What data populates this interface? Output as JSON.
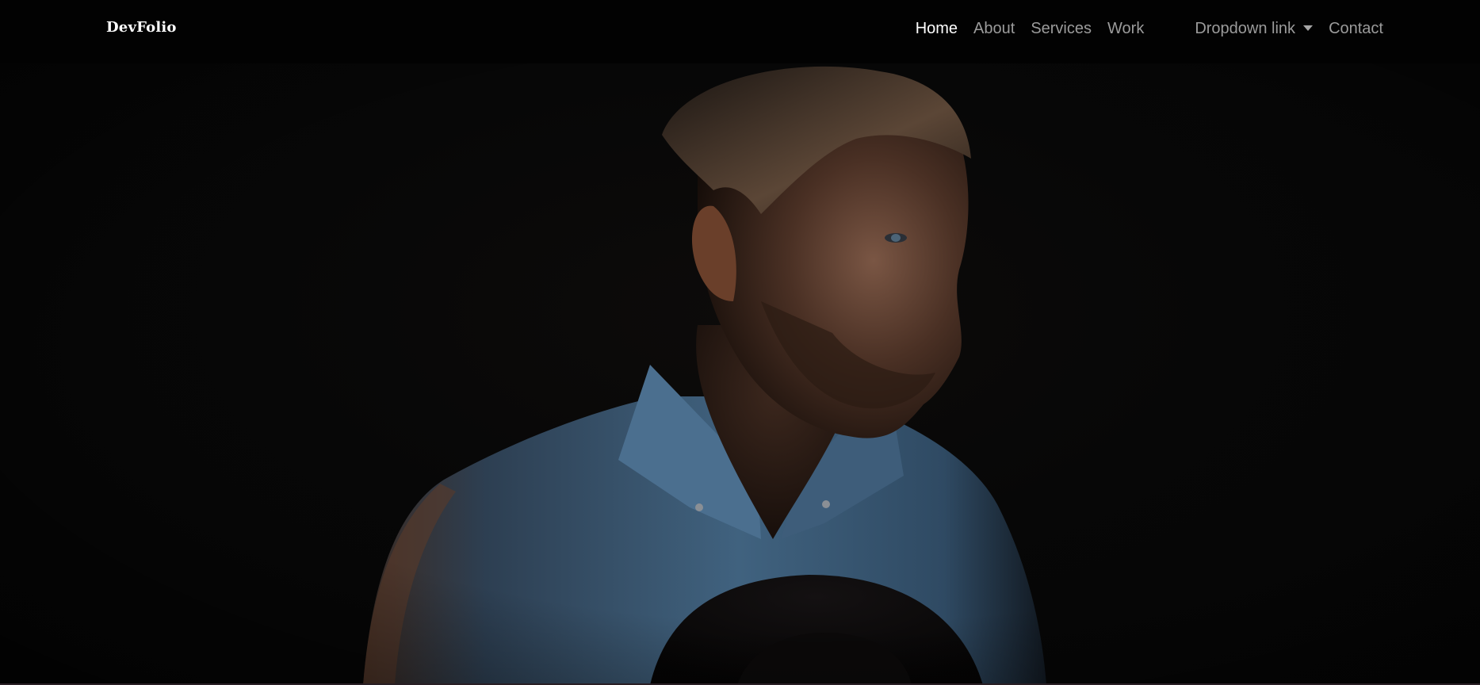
{
  "navbar": {
    "brand": "DevFolio",
    "links": [
      {
        "label": "Home",
        "active": true
      },
      {
        "label": "About"
      },
      {
        "label": "Services"
      },
      {
        "label": "Work"
      },
      {
        "label": "Dropdown link",
        "has_caret": true
      },
      {
        "label": "Contact"
      }
    ]
  },
  "colors": {
    "nav_background": "#020202",
    "active_link": "#ffffff",
    "inactive_link": "#9b9b9b",
    "shirt": "#3a5a78",
    "skin": "#4a3024"
  },
  "icons": {
    "dropdown_caret": "caret-down-icon"
  }
}
